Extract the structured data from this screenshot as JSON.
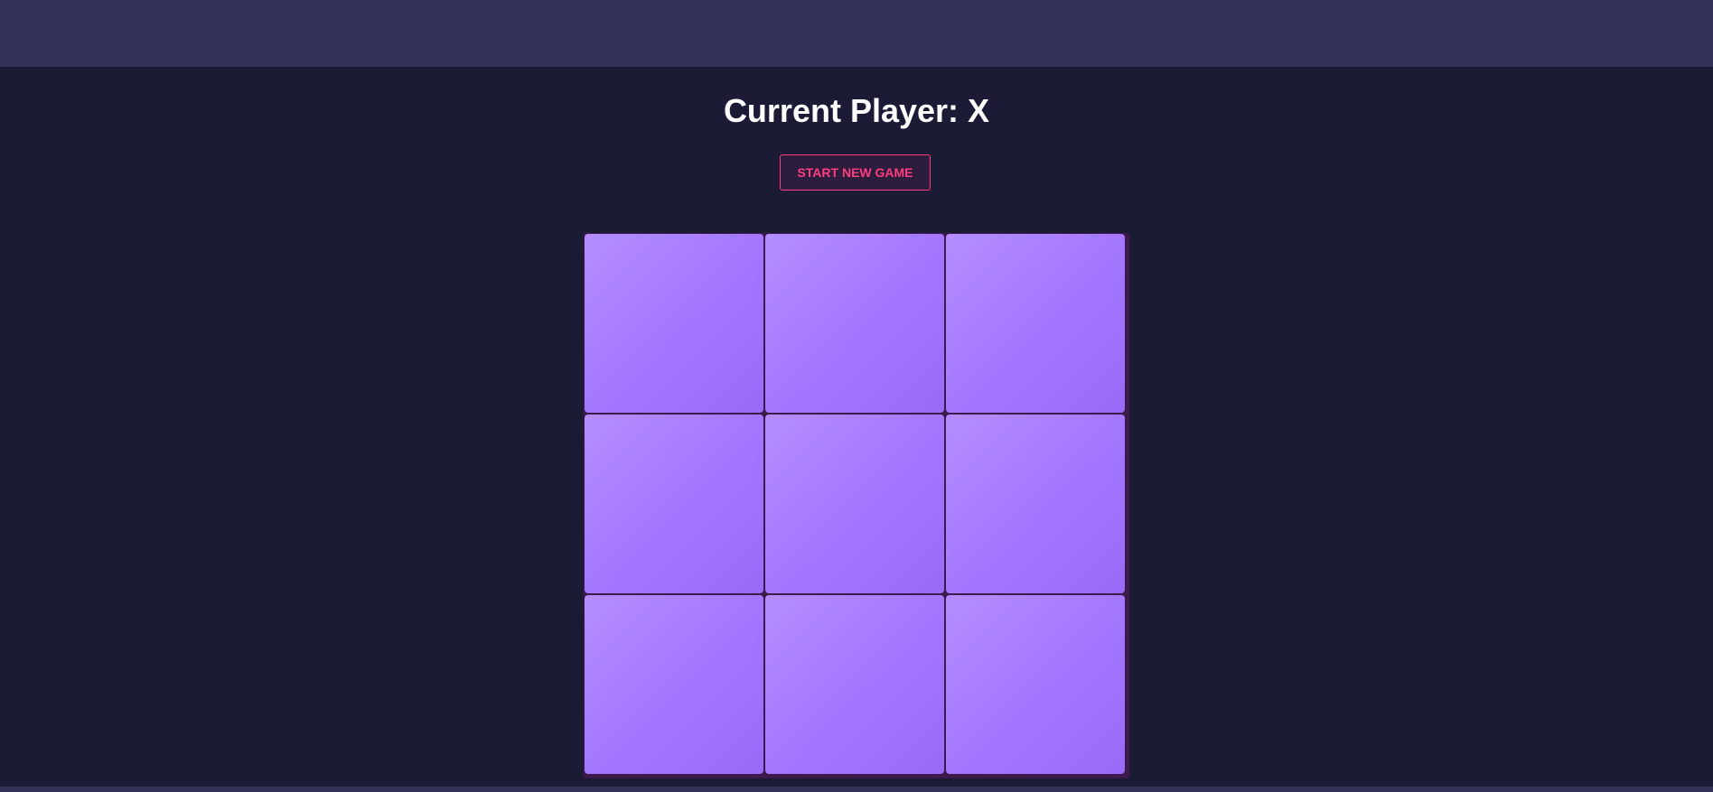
{
  "status": {
    "text": "Current Player: X",
    "current_player": "X"
  },
  "controls": {
    "new_game_label": "START NEW GAME"
  },
  "board": {
    "cells": [
      "",
      "",
      "",
      "",
      "",
      "",
      "",
      "",
      ""
    ]
  },
  "colors": {
    "background": "#1b1b36",
    "topbar": "#33325a",
    "accent": "#ff3d7f",
    "cell_light": "#b48dff",
    "cell_dark": "#9b6af8",
    "grid_line": "#3d1a4c"
  }
}
